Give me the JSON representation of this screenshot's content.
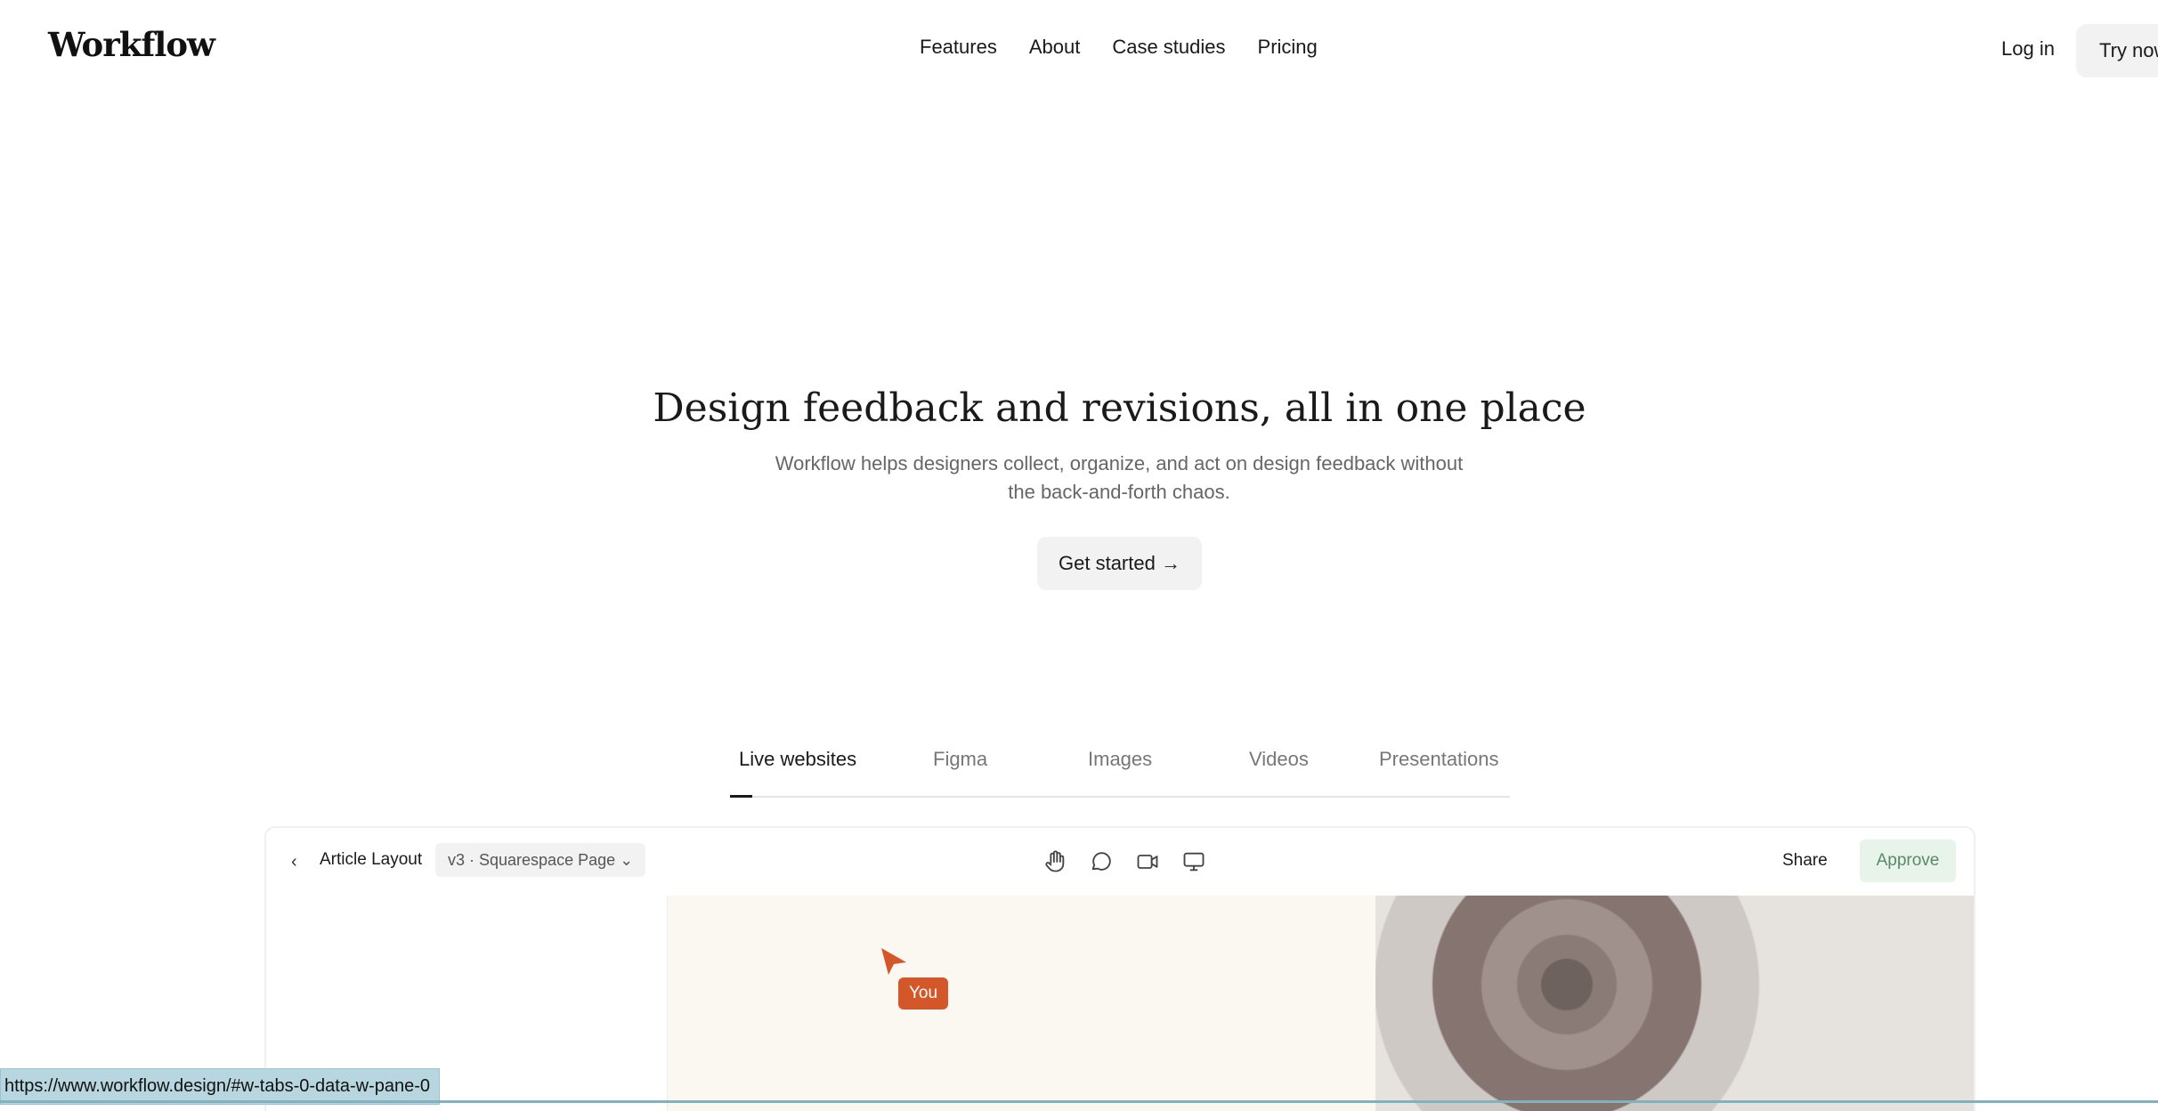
{
  "brand": {
    "name": "Workflow"
  },
  "nav": {
    "links": [
      "Features",
      "About",
      "Case studies",
      "Pricing"
    ],
    "login": "Log in",
    "try_now": "Try now"
  },
  "hero": {
    "title": "Design feedback and revisions, all in one place",
    "subtitle": "Workflow helps designers collect, organize, and act on design feedback without the back-and-forth chaos.",
    "cta": "Get started →"
  },
  "tabs": [
    "Live websites",
    "Figma",
    "Images",
    "Videos",
    "Presentations"
  ],
  "active_tab": "Live websites",
  "preview": {
    "doc_title": "Article Layout",
    "version": "v3 · Squarespace Page",
    "share": "Share",
    "approve": "Approve",
    "cursor_label": "You",
    "tool_icons": [
      "hand-icon",
      "comment-icon",
      "video-icon",
      "monitor-icon"
    ]
  },
  "status_url": "https://www.workflow.design/#w-tabs-0-data-w-pane-0",
  "colors": {
    "accent": "#d4572a",
    "approve_bg": "#e8f3ea",
    "approve_text": "#5a8a66"
  }
}
